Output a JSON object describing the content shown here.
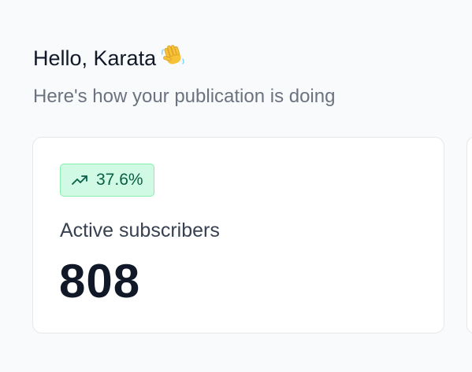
{
  "header": {
    "greeting": "Hello, Karata",
    "greeting_icon": "waving-hand-icon",
    "subtitle": "Here's how your publication is doing"
  },
  "stats": [
    {
      "label": "Active subscribers",
      "value": "808",
      "change": "37.6%",
      "change_icon": "trending-up-icon",
      "change_bg_color": "#d1fae5",
      "change_text_color": "#065f46"
    }
  ]
}
